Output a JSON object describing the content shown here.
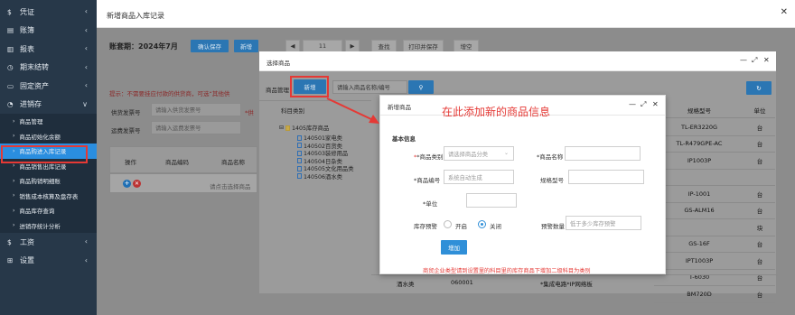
{
  "sidebar": {
    "items": [
      {
        "icon": "$",
        "label": "凭证"
      },
      {
        "icon": "▤",
        "label": "账簿"
      },
      {
        "icon": "▥",
        "label": "报表"
      },
      {
        "icon": "◷",
        "label": "期末结转"
      },
      {
        "icon": "▭",
        "label": "固定资产"
      },
      {
        "icon": "◔",
        "label": "进销存"
      }
    ],
    "sub_items": [
      {
        "label": "商品管理"
      },
      {
        "label": "商品初始化余额"
      },
      {
        "label": "商品购进入库记录"
      },
      {
        "label": "商品销售出库记录"
      },
      {
        "label": "商品购销明细账"
      },
      {
        "label": "销售成本核算及盘存表"
      },
      {
        "label": "商品库存查询"
      },
      {
        "label": "进销存统计分析"
      }
    ],
    "bottom_items": [
      {
        "icon": "$",
        "label": "工资"
      },
      {
        "icon": "⊞",
        "label": "设置"
      }
    ],
    "chevron": "‹",
    "chevron_open": "∨",
    "sub_arrow": "›"
  },
  "topbar": {
    "title": "新增商品入库记录",
    "close": "✕"
  },
  "main": {
    "period": "账套期：2024年7月",
    "save_btn": "确认保存",
    "new_btn": "新增",
    "page_prev": "◀",
    "page_no": "11",
    "page_next": "▶",
    "query_btn": "查找",
    "print_btn": "打印并保存",
    "refresh_btn": "增空",
    "warning": "提示：不需要挂应付款的供货商，可选“其他供",
    "supplier_label": "供货发票号",
    "supplier_placeholder": "请输入供货发票号",
    "shipping_label": "运费发票号",
    "shipping_placeholder": "请输入运费发票号",
    "star_label": "*供",
    "operation_header": "操作",
    "code_header": "商品编码",
    "name_header": "商品名称",
    "select_placeholder": "请点击选择商品"
  },
  "select_dialog": {
    "title": "选择商品",
    "category_label": "商品管理",
    "new_btn": "新增",
    "search_placeholder": "请输入商品名称/编号",
    "search_icon": "search-icon",
    "refresh_icon": "refresh-icon",
    "tree_header": "科目类别",
    "tree_root": "1405库存商品",
    "tree_nodes": [
      "140501家电类",
      "140502百货类",
      "140503装修用品",
      "140504日杂类",
      "140505文化用品类",
      "140506酒水类"
    ],
    "spec_header": "规格型号",
    "unit_header": "单位",
    "rows": [
      {
        "spec": "TL-ER3220G",
        "unit": "台"
      },
      {
        "spec": "TL-R479GPE-AC",
        "unit": "台"
      },
      {
        "spec": "IP1003P",
        "unit": "台"
      },
      {
        "spec": "",
        "unit": ""
      },
      {
        "spec": "IP-1001",
        "unit": "台"
      },
      {
        "spec": "GS-ALM16",
        "unit": "台"
      },
      {
        "spec": "",
        "unit": "块"
      },
      {
        "spec": "GS-16F",
        "unit": "台"
      },
      {
        "spec": "IPT1003P",
        "unit": "台"
      },
      {
        "spec": "T-6030",
        "unit": "台"
      },
      {
        "spec": "BM720D",
        "unit": "台"
      }
    ],
    "bottom_row": {
      "category": "酒水类",
      "code": "060001",
      "name": "*集成电路*IP网络板"
    },
    "win_controls": [
      "—",
      "⤢",
      "✕"
    ]
  },
  "new_dialog": {
    "title": "新增商品",
    "annotation": "在此添加新的商品信息",
    "section": "基本信息",
    "fields": {
      "category_label": "*商品类别",
      "category_placeholder": "请选择商品分类",
      "name_label": "*商品名称",
      "code_label": "*商品编号",
      "code_placeholder": "系统自动生成",
      "spec_label": "规格型号",
      "unit_label": "*单位",
      "stock_warn_label": "库存预警",
      "warn_on": "开启",
      "warn_off": "关闭",
      "warn_qty_label": "预警数量",
      "warn_qty_placeholder": "低于多少库存预警"
    },
    "add_btn": "增加",
    "note": "商贸企业类型请到设置里的科目里的库存商品下增加二级科目为类别",
    "win_controls": [
      "—",
      "⤢",
      "✕"
    ]
  },
  "colors": {
    "sidebar_bg": "#273849",
    "accent": "#2f8fd8",
    "highlight": "#e53935"
  }
}
